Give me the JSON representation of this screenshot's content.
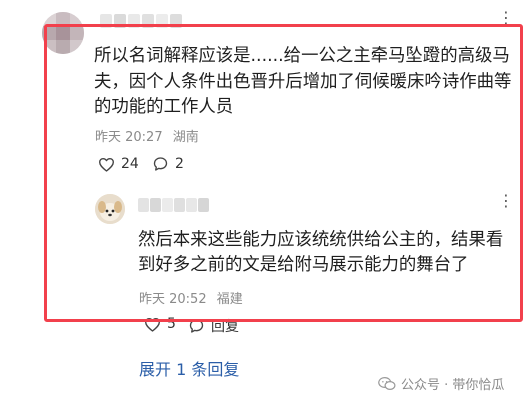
{
  "comment": {
    "text": "所以名词解释应该是......给一公之主牵马坠蹬的高级马夫，因个人条件出色晋升后增加了伺候暖床吟诗作曲等的功能的工作人员",
    "time": "昨天 20:27",
    "location": "湖南",
    "like_count": "24",
    "reply_count": "2"
  },
  "reply": {
    "text": "然后本来这些能力应该统统供给公主的，结果看到好多之前的文是给附马展示能力的舞台了",
    "time": "昨天 20:52",
    "location": "福建",
    "like_count": "5",
    "reply_label": "回复"
  },
  "expand_label": "展开 1 条回复",
  "watermark": "公众号 · 带你恰瓜",
  "more_icon": "⋮",
  "colors": {
    "highlight": "#f2404c",
    "link": "#2b5ea8",
    "meta": "#8a8a8a"
  }
}
